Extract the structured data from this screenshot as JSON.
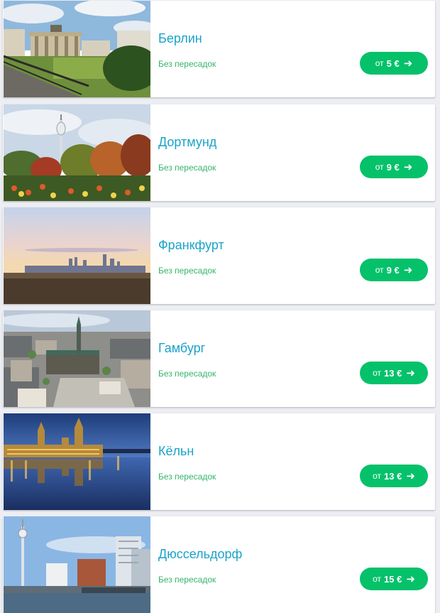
{
  "destinations": [
    {
      "city": "Берлин",
      "stops": "Без пересадок",
      "price_from": "от",
      "price": "5 €",
      "image": "brandenburg-gate-photo"
    },
    {
      "city": "Дортмунд",
      "stops": "Без пересадок",
      "price_from": "от",
      "price": "9 €",
      "image": "dortmund-tower-park-photo"
    },
    {
      "city": "Франкфурт",
      "stops": "Без пересадок",
      "price_from": "от",
      "price": "9 €",
      "image": "frankfurt-skyline-photo"
    },
    {
      "city": "Гамбург",
      "stops": "Без пересадок",
      "price_from": "от",
      "price": "13 €",
      "image": "hamburg-rathaus-aerial-photo"
    },
    {
      "city": "Кёльн",
      "stops": "Без пересадок",
      "price_from": "от",
      "price": "13 €",
      "image": "night-river-reflection-photo"
    },
    {
      "city": "Дюссельдорф",
      "stops": "Без пересадок",
      "price_from": "от",
      "price": "15 €",
      "image": "dusseldorf-rhine-tower-photo"
    }
  ],
  "icons": {
    "arrow": "arrow-right-icon"
  },
  "colors": {
    "city": "#1aa3c9",
    "stops": "#35b56a",
    "button": "#05c16a",
    "page_bg": "#eceef3"
  }
}
